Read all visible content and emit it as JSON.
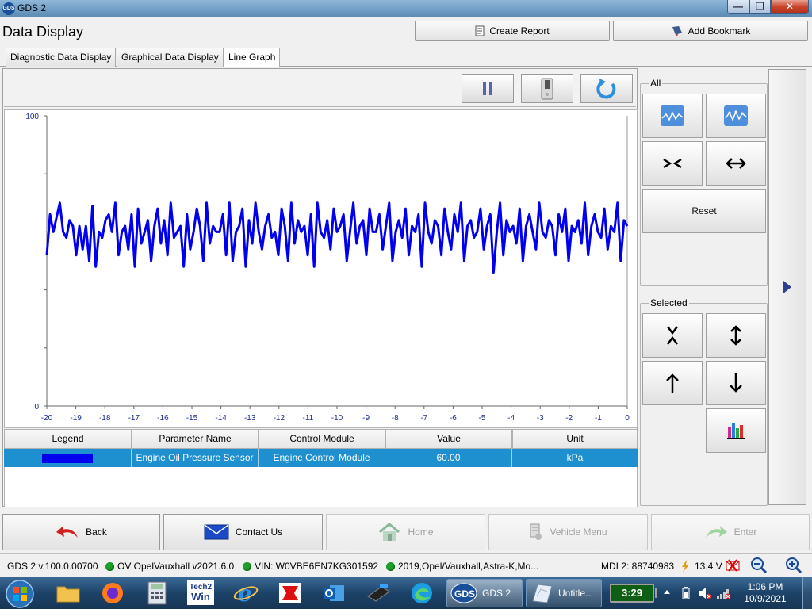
{
  "window": {
    "title": "GDS 2",
    "app_icon_text": "GDS",
    "controls": {
      "minimize": "—",
      "maximize": "❐",
      "close": "✕"
    }
  },
  "header": {
    "page_title": "Data Display",
    "create_report_label": "Create Report",
    "add_bookmark_label": "Add Bookmark"
  },
  "tabs": [
    {
      "label": "Diagnostic Data Display",
      "active": false
    },
    {
      "label": "Graphical Data Display",
      "active": false
    },
    {
      "label": "Line Graph",
      "active": true
    }
  ],
  "graph_toolbar": {
    "pause_icon": "pause-icon",
    "record_icon": "record-switch-icon",
    "refresh_icon": "refresh-icon"
  },
  "right_panel": {
    "all_label": "All",
    "selected_label": "Selected",
    "reset_label": "Reset",
    "expand_icon": "play-right-icon"
  },
  "chart_data": {
    "type": "line",
    "title": "",
    "xlabel": "",
    "ylabel": "",
    "x_ticks": [
      "-20",
      "-19",
      "-18",
      "-17",
      "-16",
      "-15",
      "-14",
      "-13",
      "-12",
      "-11",
      "-10",
      "-9",
      "-8",
      "-7",
      "-6",
      "-5",
      "-4",
      "-3",
      "-2",
      "-1",
      "0"
    ],
    "y_ticks": [
      "100",
      "0"
    ],
    "xlim": [
      -20,
      0
    ],
    "ylim": [
      0,
      100
    ],
    "grid": false,
    "series": [
      {
        "color": "#0000ee",
        "values": [
          52,
          66,
          60,
          65,
          70,
          60,
          58,
          64,
          62,
          52,
          62,
          54,
          62,
          50,
          69,
          48,
          60,
          58,
          64,
          66,
          60,
          70,
          52,
          60,
          62,
          54,
          66,
          48,
          68,
          56,
          60,
          64,
          50,
          62,
          68,
          56,
          64,
          52,
          70,
          58,
          60,
          62,
          48,
          66,
          54,
          60,
          68,
          62,
          50,
          70,
          56,
          62,
          60,
          60,
          66,
          52,
          70,
          50,
          60,
          62,
          68,
          48,
          64,
          56,
          70,
          60,
          54,
          62,
          66,
          58,
          60,
          52,
          68,
          62,
          50,
          70,
          56,
          64,
          60,
          62,
          52,
          66,
          48,
          70,
          60,
          58,
          64,
          54,
          68,
          60,
          62,
          66,
          50,
          60,
          70,
          56,
          62,
          64,
          52,
          68,
          60,
          60,
          66,
          54,
          62,
          70,
          50,
          60,
          64,
          58,
          68,
          52,
          62,
          60,
          66,
          48,
          70,
          60,
          56,
          64,
          62,
          52,
          68,
          60,
          54,
          66,
          60,
          70,
          50,
          62,
          64,
          58,
          60,
          68,
          54,
          62,
          66,
          46,
          60,
          70,
          52,
          64,
          60,
          62,
          56,
          68,
          50,
          62,
          66,
          60,
          54,
          70,
          60,
          58,
          64,
          62,
          52,
          66,
          60,
          68,
          50,
          62,
          60,
          64,
          56,
          70,
          52,
          62,
          66,
          60,
          58,
          68,
          54,
          62,
          60,
          70,
          50,
          64,
          62
        ]
      }
    ]
  },
  "table": {
    "headers": [
      "Legend",
      "Parameter Name",
      "Control Module",
      "Value",
      "Unit"
    ],
    "rows": [
      {
        "parameter": "Engine Oil Pressure Sensor",
        "module": "Engine Control Module",
        "value": "60.00",
        "unit": "kPa"
      }
    ]
  },
  "nav": {
    "back": "Back",
    "contact": "Contact Us",
    "home": "Home",
    "vehicle_menu": "Vehicle Menu",
    "enter": "Enter"
  },
  "status": {
    "version": "GDS 2 v.100.0.00700",
    "database": "OV OpelVauxhall v2021.6.0",
    "vin": "VIN: W0VBE6EN7KG301592",
    "vehicle": "2019,Opel/Vauxhall,Astra-K,Mo...",
    "mdi": "MDI 2: 88740983",
    "voltage": "13.4 V"
  },
  "taskbar": {
    "tasks": [
      "GDS 2",
      "Untitle..."
    ],
    "battery_time": "3:29",
    "clock_time": "1:06 PM",
    "clock_date": "10/9/2021",
    "tech2_line1": "Tech2",
    "tech2_line2": "Win"
  }
}
